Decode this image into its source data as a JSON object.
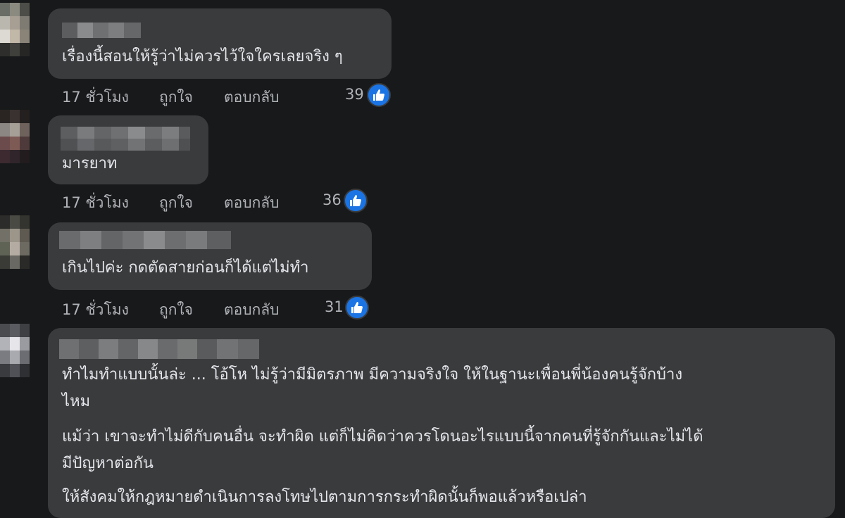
{
  "comments": [
    {
      "text_lines": [
        "เรื่องนี้สอนให้รู้ว่าไม่ควรไว้ใจใครเลยจริง ๆ"
      ],
      "time": "17 ชั่วโมง",
      "like_action": "ถูกใจ",
      "reply_action": "ตอบกลับ",
      "like_count": "39"
    },
    {
      "text_lines": [
        "มารยาท"
      ],
      "time": "17 ชั่วโมง",
      "like_action": "ถูกใจ",
      "reply_action": "ตอบกลับ",
      "like_count": "36"
    },
    {
      "text_lines": [
        "เกินไปค่ะ กดตัดสายก่อนก็ได้แต่ไม่ทำ"
      ],
      "time": "17 ชั่วโมง",
      "like_action": "ถูกใจ",
      "reply_action": "ตอบกลับ",
      "like_count": "31"
    },
    {
      "text_lines": [
        "ทำไมทำแบบนั้นล่ะ ... โอ้โห ไม่รู้ว่ามีมิตรภาพ มีความจริงใจ ให้ในฐานะเพื่อนพี่น้องคนรู้จักบ้าง",
        "ไหม",
        "แม้ว่า เขาจะทำไม่ดีกับคนอื่น จะทำผิด แต่ก็ไม่คิดว่าควรโดนอะไรแบบนี้จากคนที่รู้จักกันและไม่ได้",
        "มีปัญหาต่อกัน",
        "ให้สังคมให้กฎหมายดำเนินการลงโทษไปตามการกระทำผิดนั้นก็พอแล้วหรือเปล่า"
      ]
    }
  ],
  "icons": {
    "like": "thumbs-up-icon"
  },
  "colors": {
    "background": "#18191a",
    "bubble": "#3a3b3c",
    "meta": "#b0b3b8",
    "like": "#1b74e4"
  }
}
